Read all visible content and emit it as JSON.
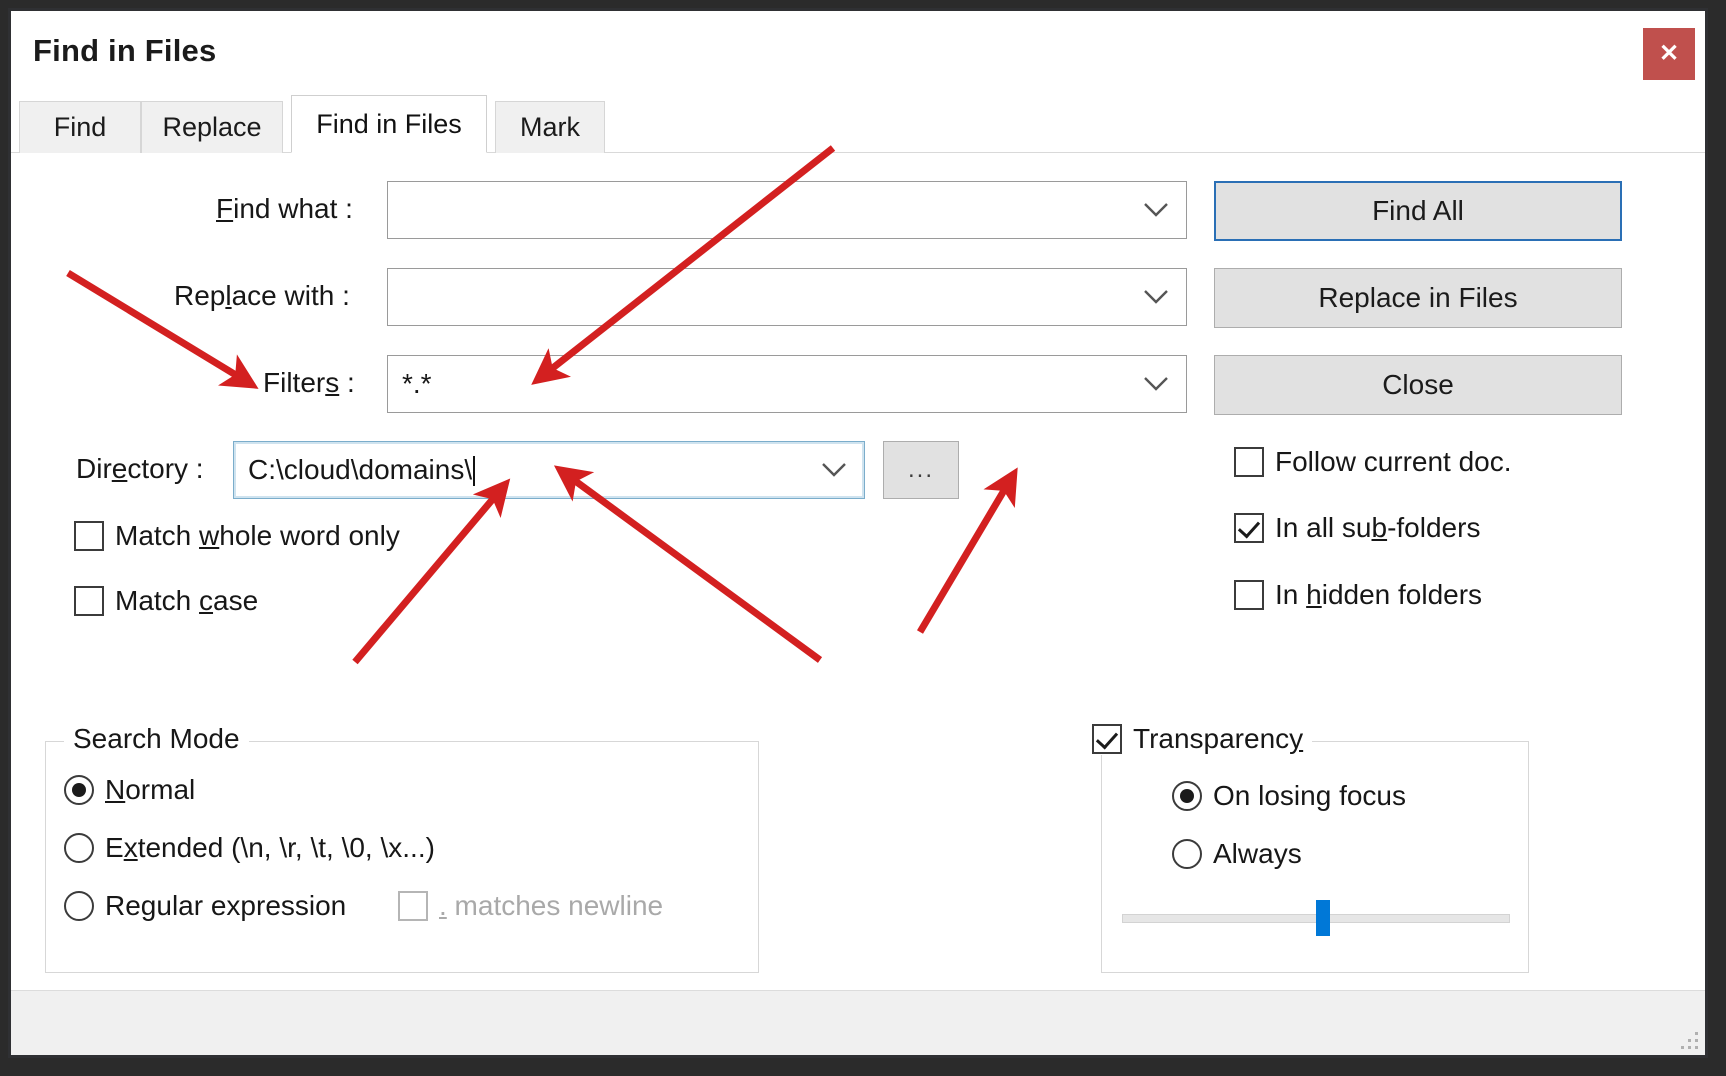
{
  "window": {
    "title": "Find in Files",
    "close_label": "×",
    "close_icon": "close-icon",
    "close_color": "#c0504d"
  },
  "tabs": [
    {
      "label": "Find",
      "active": false
    },
    {
      "label": "Replace",
      "active": false
    },
    {
      "label": "Find in Files",
      "active": true
    },
    {
      "label": "Mark",
      "active": false
    }
  ],
  "fields": {
    "find_what": {
      "label_prefix": "",
      "label_accel": "F",
      "label_suffix": "ind what :",
      "value": "",
      "placeholder": ""
    },
    "replace_with": {
      "label_prefix": "Rep",
      "label_accel": "l",
      "label_suffix": "ace with :",
      "value": "",
      "placeholder": ""
    },
    "filters": {
      "label_prefix": "Filter",
      "label_accel": "s",
      "label_suffix": " :",
      "value": "*.*",
      "placeholder": ""
    },
    "directory": {
      "label_prefix": "Dir",
      "label_accel": "e",
      "label_suffix": "ctory :",
      "value": "C:\\cloud\\domains\\",
      "placeholder": "",
      "focused": true,
      "browse_label": "..."
    }
  },
  "buttons": {
    "find_all": "Find All",
    "replace_in_files": "Replace in Files",
    "close": "Close"
  },
  "left_checkboxes": [
    {
      "prefix": "Match ",
      "accel": "w",
      "suffix": "hole word only",
      "checked": false,
      "name": "match-whole-word-only"
    },
    {
      "prefix": "Match ",
      "accel": "c",
      "suffix": "ase",
      "checked": false,
      "name": "match-case"
    }
  ],
  "right_checkboxes": [
    {
      "prefix": "Follow current doc.",
      "accel": "",
      "suffix": "",
      "checked": false,
      "name": "follow-current-doc"
    },
    {
      "prefix": "In all su",
      "accel": "b",
      "suffix": "-folders",
      "checked": true,
      "name": "in-all-sub-folders"
    },
    {
      "prefix": "In ",
      "accel": "h",
      "suffix": "idden folders",
      "checked": false,
      "name": "in-hidden-folders"
    }
  ],
  "search_mode": {
    "legend": "Search Mode",
    "options": [
      {
        "prefix": "",
        "accel": "N",
        "suffix": "ormal",
        "selected": true,
        "name": "search-mode-normal"
      },
      {
        "prefix": "E",
        "accel": "x",
        "suffix": "tended (\\n, \\r, \\t, \\0, \\x...)",
        "selected": false,
        "name": "search-mode-extended"
      },
      {
        "prefix": "Re",
        "accel": "g",
        "suffix": "ular expression",
        "selected": false,
        "name": "search-mode-regex"
      }
    ],
    "dot_matches_newline": {
      "prefix": "",
      "accel": ".",
      "suffix": " matches newline",
      "checked": false,
      "disabled": true
    }
  },
  "transparency": {
    "label_prefix": "Transparenc",
    "label_accel": "y",
    "label_suffix": "",
    "checked": true,
    "options": [
      {
        "label": "On losing focus",
        "selected": true,
        "name": "transparency-on-losing-focus"
      },
      {
        "label": "Always",
        "selected": false,
        "name": "transparency-always"
      }
    ],
    "slider_percent": 52,
    "slider_color": "#0078d7"
  },
  "annotations": {
    "color": "#d32020",
    "count": 5
  }
}
